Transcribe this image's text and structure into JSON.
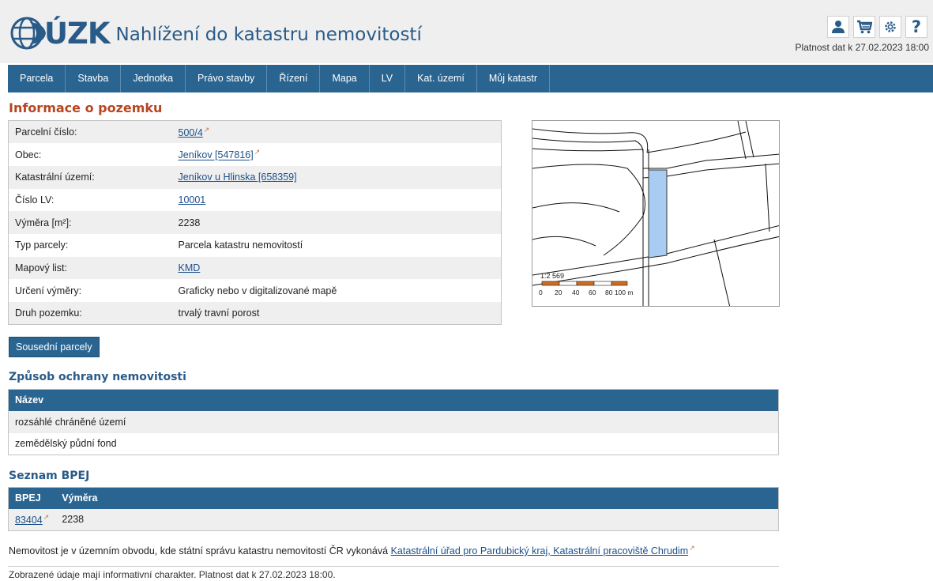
{
  "header": {
    "logo_text": "ÚZK",
    "site_title": "Nahlížení do katastru nemovitostí",
    "validity": "Platnost dat k 27.02.2023 18:00",
    "icons": [
      "user-icon",
      "cart-icon",
      "gear-icon",
      "help-icon"
    ],
    "help_glyph": "?"
  },
  "nav": [
    "Parcela",
    "Stavba",
    "Jednotka",
    "Právo stavby",
    "Řízení",
    "Mapa",
    "LV",
    "Kat. území",
    "Můj katastr"
  ],
  "parcel": {
    "heading": "Informace o pozemku",
    "rows": [
      {
        "label": "Parcelní číslo:",
        "value": "500/4",
        "link": true,
        "ext": true
      },
      {
        "label": "Obec:",
        "value": "Jeníkov [547816]",
        "link": true,
        "ext": true
      },
      {
        "label": "Katastrální území:",
        "value": "Jeníkov u Hlinska [658359]",
        "link": true,
        "ext": false
      },
      {
        "label": "Číslo LV:",
        "value": "10001",
        "link": true,
        "ext": false
      },
      {
        "label": "Výměra [m²]:",
        "value": "2238",
        "link": false,
        "ext": false
      },
      {
        "label": "Typ parcely:",
        "value": "Parcela katastru nemovitostí",
        "link": false,
        "ext": false
      },
      {
        "label": "Mapový list:",
        "value": "KMD",
        "link": true,
        "ext": false
      },
      {
        "label": "Určení výměry:",
        "value": "Graficky nebo v digitalizované mapě",
        "link": false,
        "ext": false
      },
      {
        "label": "Druh pozemku:",
        "value": "trvalý travní porost",
        "link": false,
        "ext": false
      }
    ]
  },
  "map": {
    "scale": "1:2 569",
    "scale_ticks": [
      "0",
      "20",
      "40",
      "60",
      "80 100 m"
    ],
    "parcel_fill": "#a9cdf2"
  },
  "neighbors_button": "Sousední parcely",
  "protection": {
    "heading": "Způsob ochrany nemovitosti",
    "column": "Název",
    "rows": [
      "rozsáhlé chráněné území",
      "zemědělský půdní fond"
    ]
  },
  "bpej": {
    "heading": "Seznam BPEJ",
    "columns": [
      "BPEJ",
      "Výměra"
    ],
    "rows": [
      {
        "code": "83404",
        "area": "2238"
      }
    ]
  },
  "notice": {
    "text": "Nemovitost je v územním obvodu, kde státní správu katastru nemovitostí ČR vykonává",
    "link": "Katastrální úřad pro Pardubický kraj, Katastrální pracoviště Chrudim"
  },
  "footer": "Zobrazené údaje mají informativní charakter. Platnost dat k 27.02.2023 18:00.",
  "colors": {
    "primary": "#2a6592",
    "heading_orange": "#b8451f",
    "link": "#1a4f8b"
  }
}
